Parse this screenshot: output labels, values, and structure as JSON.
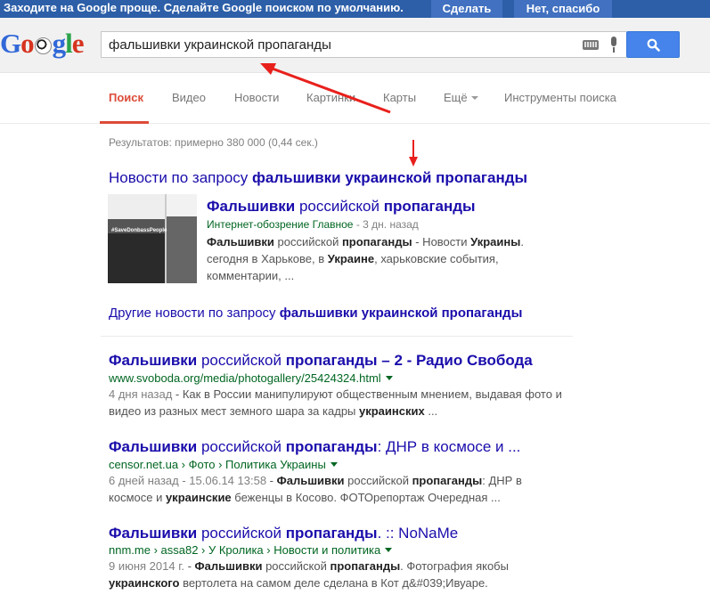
{
  "promo": {
    "text": "Заходите на Google проще. Сделайте Google поиском по умолчанию.",
    "accept": "Сделать",
    "decline": "Нет, спасибо"
  },
  "logo": {
    "letters": [
      "G",
      "o",
      "o",
      "g",
      "l",
      "e"
    ]
  },
  "search": {
    "query": "фальшивки украинской пропаганды"
  },
  "tabs": {
    "search": "Поиск",
    "video": "Видео",
    "news": "Новости",
    "images": "Картинки",
    "maps": "Карты",
    "more": "Ещё",
    "tools": "Инструменты поиска"
  },
  "stats": "Результатов: примерно 380 000 (0,44 сек.)",
  "news_block": {
    "heading_prefix": "Новости по запросу ",
    "heading_query": "фальшивки украинской пропаганды",
    "item": {
      "title_b1": "Фальшивки",
      "title_mid": " российской ",
      "title_b2": "пропаганды",
      "source": "Интернет-обозрение Главное",
      "age": " - 3 дн. назад",
      "snippet_l1_b": "Фальшивки",
      "snippet_l1_a": " российской ",
      "snippet_l1_b2": "пропаганды",
      "snippet_l1_c": " - Новости ",
      "snippet_l1_b3": "Украины",
      "snippet_l1_d": ".",
      "snippet_l2_a": "сегодня в Харькове, в ",
      "snippet_l2_b": "Украине",
      "snippet_l2_c": ", харьковские события,",
      "snippet_l3": "комментарии, ..."
    },
    "thumb_caption": "#SaveDonbassPeople",
    "more_prefix": "Другие новости по запросу ",
    "more_query": "фальшивки украинской пропаганды"
  },
  "results": [
    {
      "title_b1": "Фальшивки",
      "title_mid": " российской ",
      "title_b2": "пропаганды – 2 - Радио Свобода",
      "url": "www.svoboda.org/media/photogallery/25424324.html",
      "snip_date": "4 дня назад",
      "snip_l1": " - Как в России манипулируют общественным мнением, выдавая фото и",
      "snip_l2_a": "видео из разных мест земного шара за кадры ",
      "snip_l2_b": "украинских",
      "snip_l2_c": " ..."
    },
    {
      "title_b1": "Фальшивки",
      "title_mid": " российской ",
      "title_b2": "пропаганды",
      "title_tail": ": ДНР в космосе и ...",
      "url": "censor.net.ua › Фото › Политика Украины",
      "snip_date": "6 дней назад - 15.06.14 13:58",
      "snip_l1_a": " - ",
      "snip_l1_b": "Фальшивки",
      "snip_l1_c": " российской ",
      "snip_l1_d": "пропаганды",
      "snip_l1_e": ": ДНР в",
      "snip_l2_a": "космосе и ",
      "snip_l2_b": "украинские",
      "snip_l2_c": " беженцы в Косово. ФОТОрепортаж Очередная ..."
    },
    {
      "title_b1": "Фальшивки",
      "title_mid": " российской ",
      "title_b2": "пропаганды",
      "title_tail": ". :: NoNaMe",
      "url": "nnm.me › assa82 › У Кролика › Новости и политика",
      "snip_date": "9 июня 2014 г.",
      "snip_l1_a": " - ",
      "snip_l1_b": "Фальшивки",
      "snip_l1_c": " российской ",
      "snip_l1_d": "пропаганды",
      "snip_l1_e": ". Фотография якобы",
      "snip_l2_a": "украинского",
      "snip_l2_b": " вертолета на самом деле сделана в Кот д&#039;Ивуаре."
    }
  ],
  "colors": {
    "promo_bg": "#2d5fa8",
    "link": "#1a0dab",
    "url_green": "#006621",
    "active_tab": "#dd4b39",
    "annotation_arrow": "#e8201c"
  }
}
